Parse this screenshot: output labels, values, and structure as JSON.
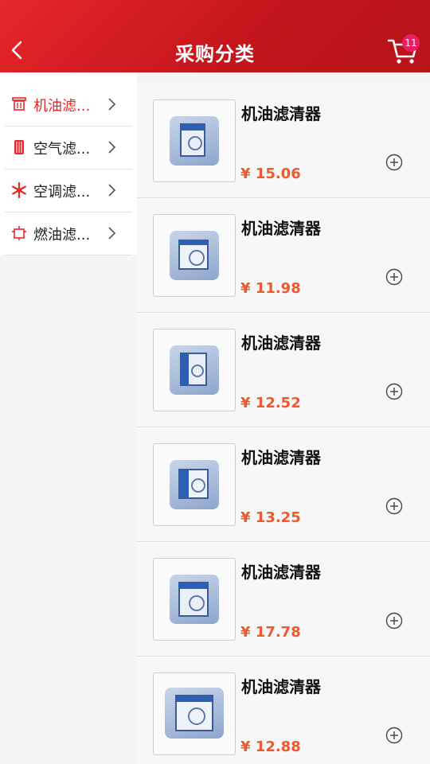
{
  "header": {
    "title": "采购分类",
    "cart_count": "11",
    "back_icon": "chevron-left-icon",
    "cart_icon": "shopping-cart-icon"
  },
  "sidebar": {
    "items": [
      {
        "label": "机油滤...",
        "icon": "oil-filter-icon",
        "active": true
      },
      {
        "label": "空气滤...",
        "icon": "air-filter-icon",
        "active": false
      },
      {
        "label": "空调滤...",
        "icon": "ac-snowflake-icon",
        "active": false
      },
      {
        "label": "燃油滤...",
        "icon": "fuel-filter-icon",
        "active": false
      }
    ]
  },
  "products": [
    {
      "name": "机油滤清器",
      "price": "¥ 15.06"
    },
    {
      "name": "机油滤清器",
      "price": "¥ 11.98"
    },
    {
      "name": "机油滤清器",
      "price": "¥ 12.52"
    },
    {
      "name": "机油滤清器",
      "price": "¥ 13.25"
    },
    {
      "name": "机油滤清器",
      "price": "¥ 17.78"
    },
    {
      "name": "机油滤清器",
      "price": "¥ 12.88"
    }
  ],
  "colors": {
    "header": "#d31d23",
    "accent": "#e8262c",
    "price": "#f0582d",
    "badge": "#e91e63"
  }
}
